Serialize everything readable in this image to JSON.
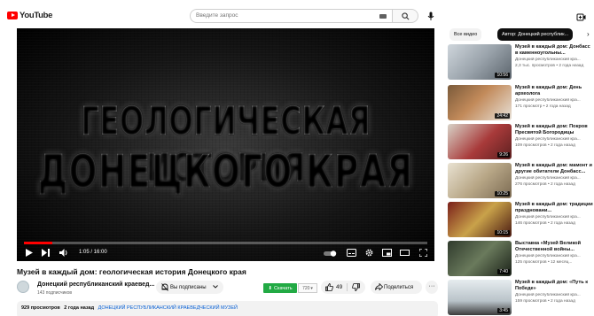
{
  "header": {
    "logo_text": "YouTube",
    "search": {
      "placeholder": "Введите запрос"
    }
  },
  "player": {
    "overlay_line1": "ГЕОЛОГИЧЕСКАЯ ИСТОРИЯ",
    "overlay_line2": "ДОНЕЦКОГО КРАЯ",
    "time_display": "1:05 / 16:00",
    "progress": 0.07
  },
  "video": {
    "title": "Музей в каждый дом: геологическая история Донецкого края",
    "channel_name": "Донецкий республиканский краевед...",
    "subscribers": "143 подписчиков",
    "subscribe_label": "Вы подписаны",
    "download_label": "Скачать",
    "download_size": "720",
    "likes": "49",
    "share_label": "Поделиться",
    "more_label": "···",
    "views": "929 просмотров",
    "date": "2 года назад",
    "hashtags": "ДОНЕЦКИЙ РЕСПУБЛИКАНСКИЙ КРАЕВЕДЧЕСКИЙ МУЗЕЙ"
  },
  "sidebar": {
    "chips": [
      "Все видео",
      "Автор: Донецкий республик..."
    ],
    "next_chevron": "›",
    "related": [
      {
        "title": "Музей в каждый дом: Донбасс в каменноугольны...",
        "channel": "Донецкий республиканский кра...",
        "meta": "2,3 тыс. просмотров • 2 года назад",
        "duration": "10:56"
      },
      {
        "title": "Музей в каждый дом: День археолога",
        "channel": "Донецкий республиканский кра...",
        "meta": "171 просмотр • 2 года назад",
        "duration": "24:42"
      },
      {
        "title": "Музей в каждый дом: Покров Пресвятой Богородицы",
        "channel": "Донецкий республиканский кра...",
        "meta": "109 просмотров • 2 года назад",
        "duration": "9:26"
      },
      {
        "title": "Музей в каждый дом: мамонт и другие обитатели Донбасс...",
        "channel": "Донецкий республиканский кра...",
        "meta": "276 просмотров • 2 года назад",
        "duration": "10:25"
      },
      {
        "title": "Музей в каждый дом: традиции праздновани...",
        "channel": "Донецкий республиканский кра...",
        "meta": "146 просмотров • 2 года назад",
        "duration": "10:15"
      },
      {
        "title": "Выставка «Музей Великой Отечественной войны...",
        "channel": "Донецкий республиканский кра...",
        "meta": "125 просмотров • 12 месяц...",
        "duration": "7:40"
      },
      {
        "title": "Музей в каждый дом: «Путь к Победе»",
        "channel": "Донецкий республиканский кра...",
        "meta": "159 просмотров • 2 года назад",
        "duration": "3:45"
      }
    ]
  },
  "colors": {
    "brand_red": "#ff0000",
    "download_green": "#22aa44",
    "link_blue": "#065fd4"
  },
  "icons": [
    "youtube-logo-icon",
    "keyboard-icon",
    "search-icon",
    "mic-icon",
    "create-icon",
    "play-icon",
    "next-icon",
    "volume-icon",
    "autoplay-icon",
    "subtitles-icon",
    "settings-icon",
    "miniplayer-icon",
    "theater-icon",
    "fullscreen-icon",
    "bell-icon",
    "chevron-down-icon",
    "download-icon",
    "thumb-up-icon",
    "thumb-down-icon",
    "share-icon",
    "more-icon"
  ]
}
